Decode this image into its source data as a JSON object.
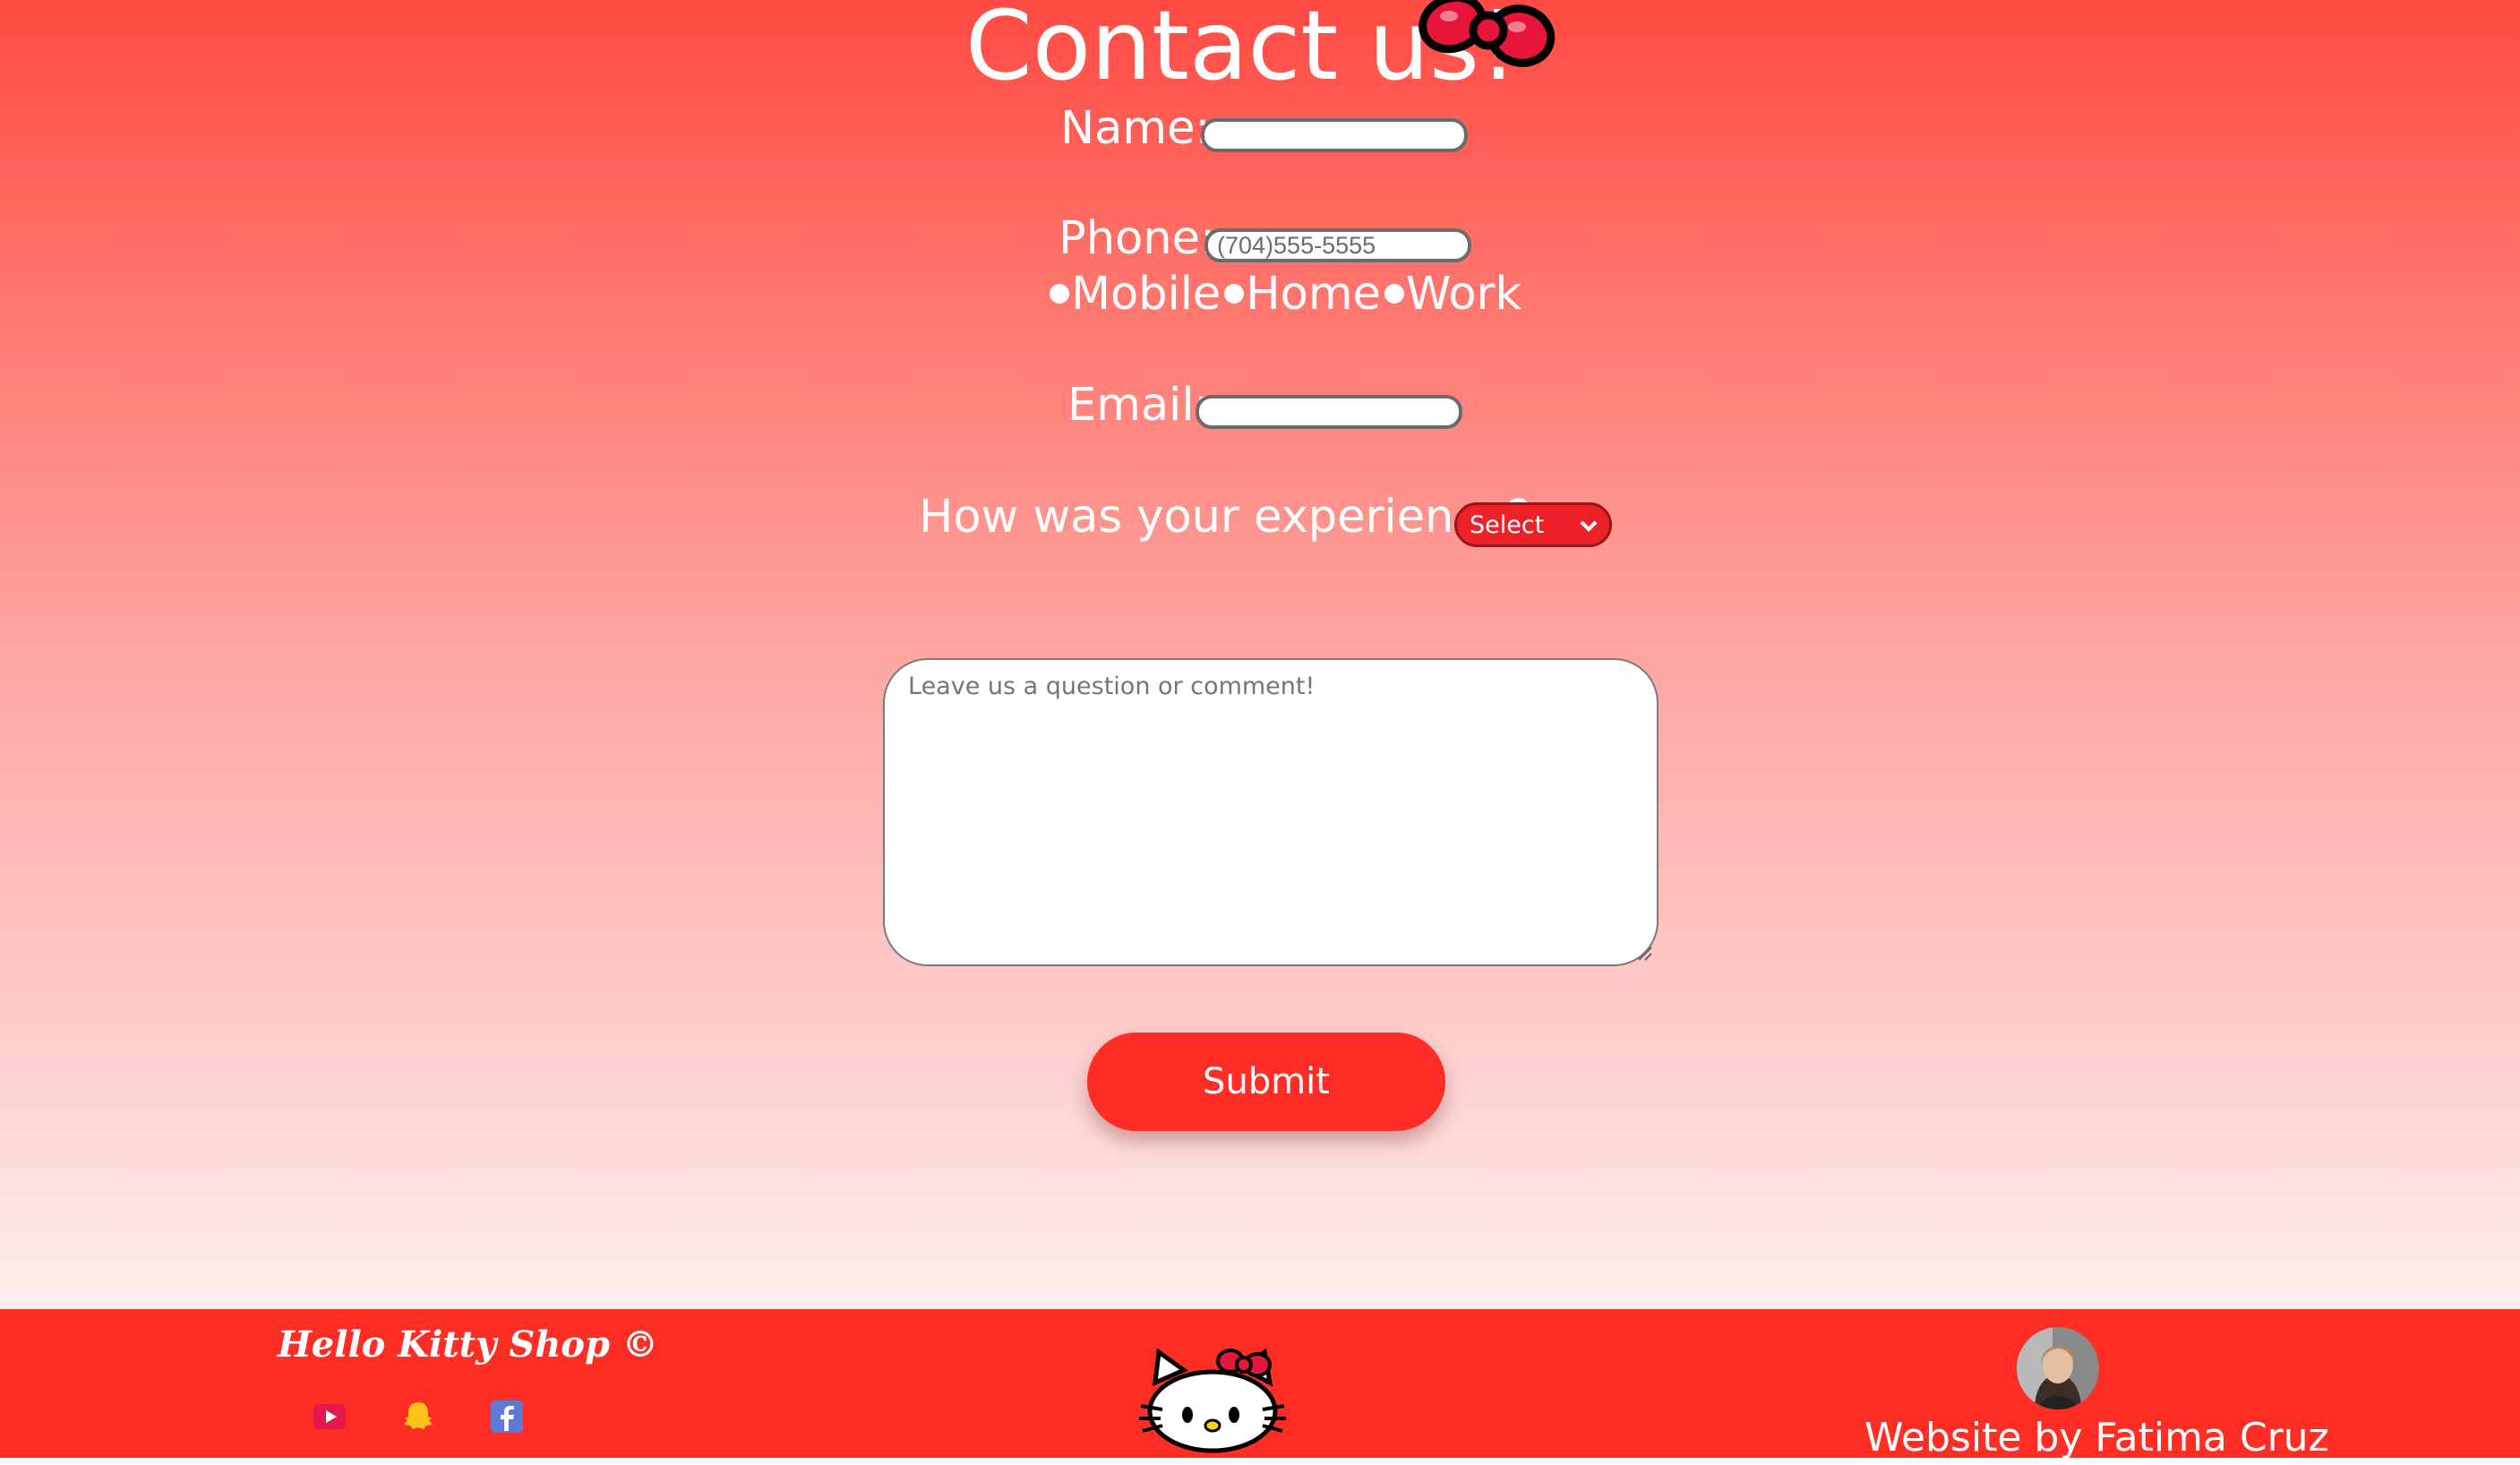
{
  "page": {
    "title": "Contact us!"
  },
  "form": {
    "name_label": "Name:",
    "phone_label": "Phone:",
    "phone_placeholder": "(704)555-5555",
    "phone_types": [
      "Mobile",
      "Home",
      "Work"
    ],
    "email_label": "Email:",
    "experience_label": "How was your experience?",
    "experience_select_value": "Select",
    "comment_placeholder": "Leave us a question or comment!",
    "submit_label": "Submit"
  },
  "footer": {
    "shop_name": "Hello Kitty Shop ©",
    "social_icons": [
      "youtube-icon",
      "snapchat-icon",
      "facebook-icon"
    ],
    "credit": "Website by Fatima Cruz"
  },
  "colors": {
    "header_gradient_top": "#ff4b43",
    "header_gradient_bottom": "#fdeeed",
    "footer_red": "#ff2e25",
    "select_red": "#ee2028",
    "submit_red": "#ff2d26"
  }
}
